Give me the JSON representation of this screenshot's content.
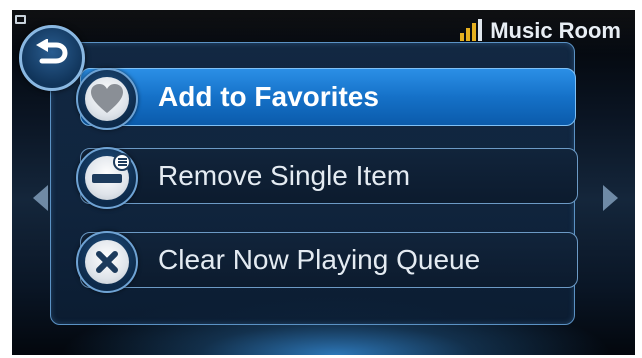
{
  "header": {
    "room_name": "Music Room",
    "signal_icon": "signal-strength-icon",
    "accent_color": "#e5b020"
  },
  "navigation": {
    "back_icon": "back-arrow-icon",
    "prev_icon": "chevron-left-icon",
    "next_icon": "chevron-right-icon"
  },
  "menu": {
    "options": [
      {
        "label": "Add to Favorites",
        "icon": "heart-icon",
        "selected": true
      },
      {
        "label": "Remove Single Item",
        "icon": "remove-item-icon",
        "selected": false
      },
      {
        "label": "Clear Now Playing Queue",
        "icon": "close-icon",
        "selected": false
      }
    ]
  },
  "colors": {
    "selected_highlight": "#1571c8",
    "border": "#6c9ac5",
    "background": "#0a1626"
  }
}
